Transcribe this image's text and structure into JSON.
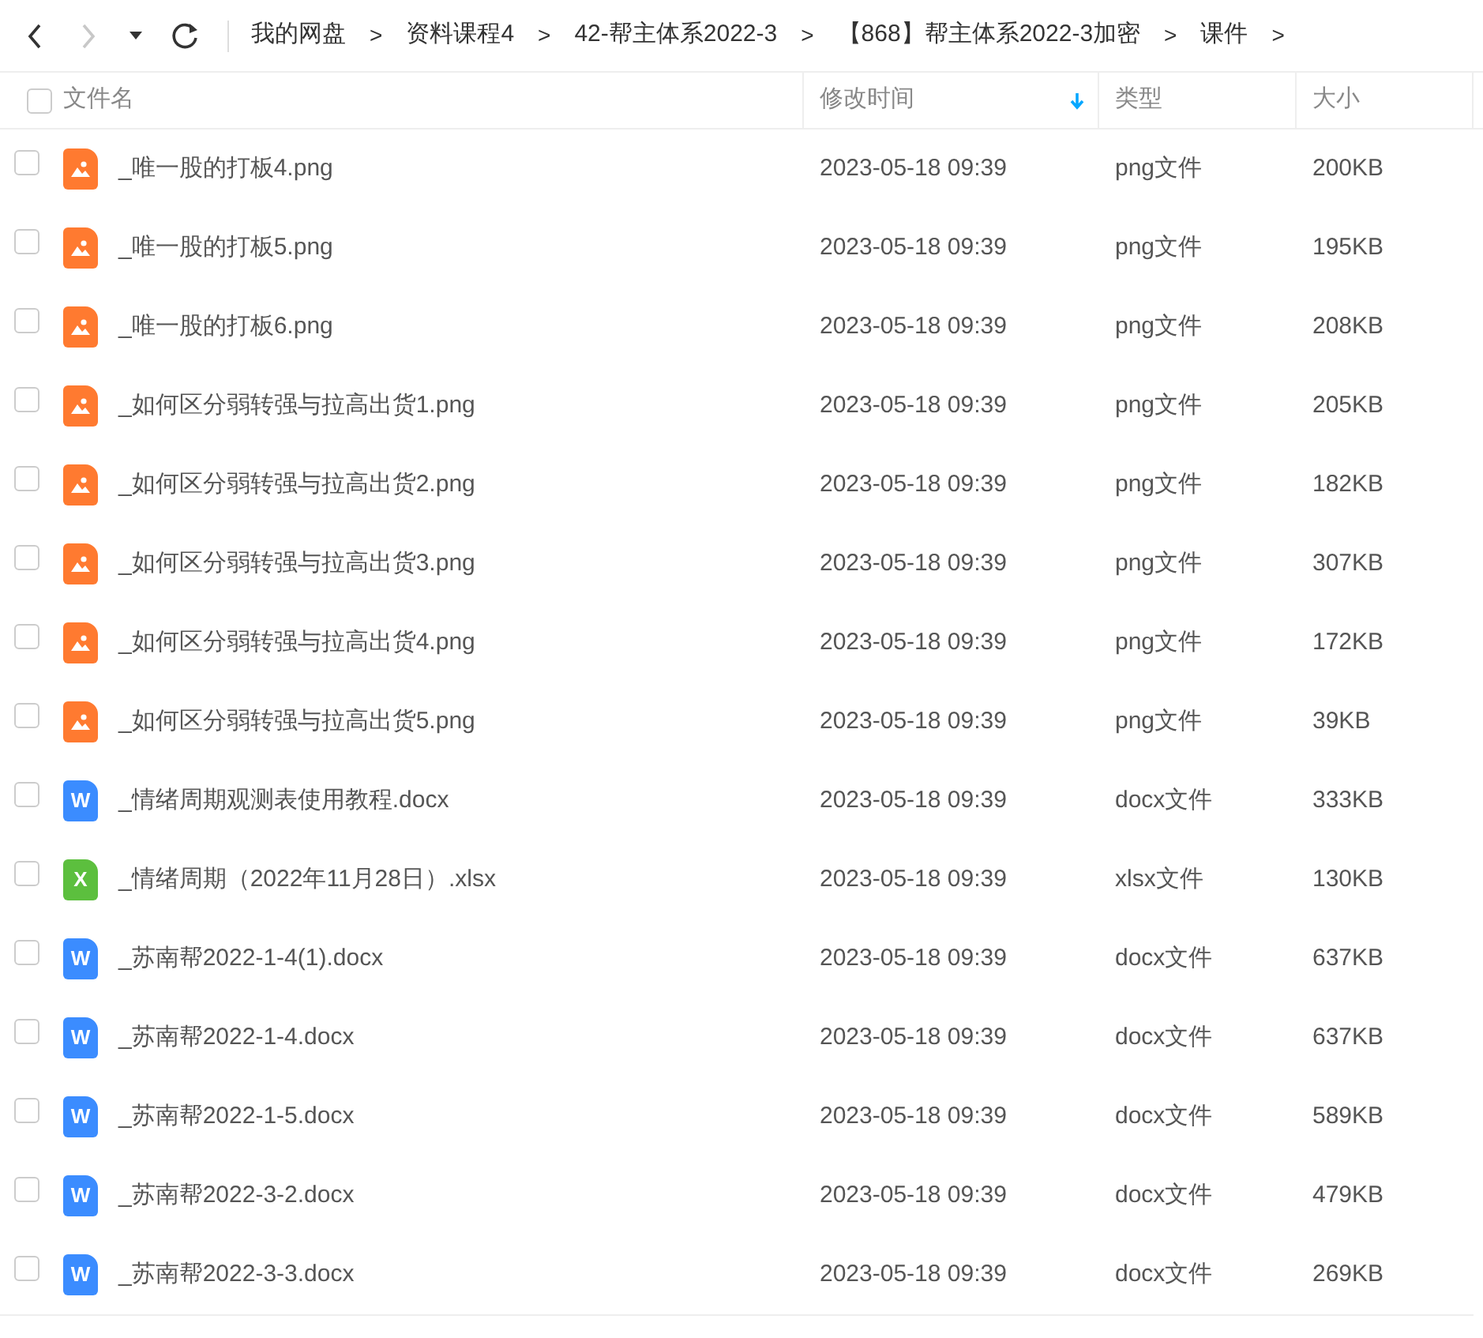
{
  "nav": [
    {
      "kind": "back",
      "disabled": false
    },
    {
      "kind": "forward",
      "disabled": true
    },
    {
      "kind": "history",
      "disabled": false
    },
    {
      "kind": "refresh",
      "disabled": false
    }
  ],
  "breadcrumb": [
    {
      "label": "我的网盘",
      "separator": ">"
    },
    {
      "label": "资料课程4",
      "separator": ">"
    },
    {
      "label": "42-帮主体系2022-3",
      "separator": ">"
    },
    {
      "label": "【868】帮主体系2022-3加密",
      "separator": ">"
    },
    {
      "label": "课件",
      "separator": ">"
    }
  ],
  "table": {
    "select_all": {
      "checked": false
    },
    "columns": [
      {
        "label": "文件名",
        "sorted": false
      },
      {
        "label": "修改时间",
        "sorted": true
      },
      {
        "label": "类型",
        "sorted": false
      },
      {
        "label": "大小",
        "sorted": false
      }
    ],
    "rows": [
      {
        "checked": false,
        "kind": "image",
        "name": "_唯一股的打板4.png",
        "modified": "2023-05-18 09:39",
        "type": "png文件",
        "size": "200KB"
      },
      {
        "checked": false,
        "kind": "image",
        "name": "_唯一股的打板5.png",
        "modified": "2023-05-18 09:39",
        "type": "png文件",
        "size": "195KB"
      },
      {
        "checked": false,
        "kind": "image",
        "name": "_唯一股的打板6.png",
        "modified": "2023-05-18 09:39",
        "type": "png文件",
        "size": "208KB"
      },
      {
        "checked": false,
        "kind": "image",
        "name": "_如何区分弱转强与拉高出货1.png",
        "modified": "2023-05-18 09:39",
        "type": "png文件",
        "size": "205KB"
      },
      {
        "checked": false,
        "kind": "image",
        "name": "_如何区分弱转强与拉高出货2.png",
        "modified": "2023-05-18 09:39",
        "type": "png文件",
        "size": "182KB"
      },
      {
        "checked": false,
        "kind": "image",
        "name": "_如何区分弱转强与拉高出货3.png",
        "modified": "2023-05-18 09:39",
        "type": "png文件",
        "size": "307KB"
      },
      {
        "checked": false,
        "kind": "image",
        "name": "_如何区分弱转强与拉高出货4.png",
        "modified": "2023-05-18 09:39",
        "type": "png文件",
        "size": "172KB"
      },
      {
        "checked": false,
        "kind": "image",
        "name": "_如何区分弱转强与拉高出货5.png",
        "modified": "2023-05-18 09:39",
        "type": "png文件",
        "size": "39KB"
      },
      {
        "checked": false,
        "kind": "word",
        "icon_letter": "W",
        "name": "_情绪周期观测表使用教程.docx",
        "modified": "2023-05-18 09:39",
        "type": "docx文件",
        "size": "333KB"
      },
      {
        "checked": false,
        "kind": "excel",
        "icon_letter": "X",
        "name": "_情绪周期（2022年11月28日）.xlsx",
        "modified": "2023-05-18 09:39",
        "type": "xlsx文件",
        "size": "130KB"
      },
      {
        "checked": false,
        "kind": "word",
        "icon_letter": "W",
        "name": "_苏南帮2022-1-4(1).docx",
        "modified": "2023-05-18 09:39",
        "type": "docx文件",
        "size": "637KB"
      },
      {
        "checked": false,
        "kind": "word",
        "icon_letter": "W",
        "name": "_苏南帮2022-1-4.docx",
        "modified": "2023-05-18 09:39",
        "type": "docx文件",
        "size": "637KB"
      },
      {
        "checked": false,
        "kind": "word",
        "icon_letter": "W",
        "name": "_苏南帮2022-1-5.docx",
        "modified": "2023-05-18 09:39",
        "type": "docx文件",
        "size": "589KB"
      },
      {
        "checked": false,
        "kind": "word",
        "icon_letter": "W",
        "name": "_苏南帮2022-3-2.docx",
        "modified": "2023-05-18 09:39",
        "type": "docx文件",
        "size": "479KB"
      },
      {
        "checked": false,
        "kind": "word",
        "icon_letter": "W",
        "name": "_苏南帮2022-3-3.docx",
        "modified": "2023-05-18 09:39",
        "type": "docx文件",
        "size": "269KB"
      }
    ]
  }
}
